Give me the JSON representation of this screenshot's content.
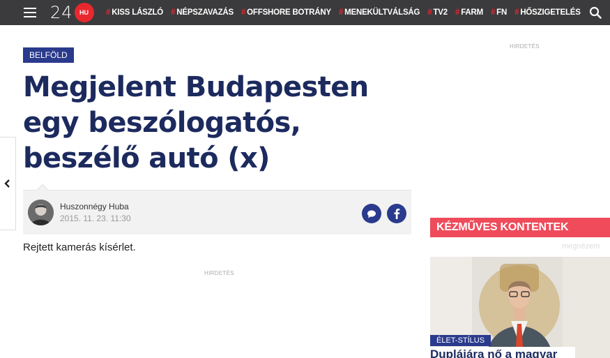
{
  "header": {
    "logo_number": "24",
    "logo_badge": "HU",
    "nav": [
      {
        "label": "KISS LÁSZLÓ"
      },
      {
        "label": "NÉPSZAVAZÁS"
      },
      {
        "label": "OFFSHORE BOTRÁNY"
      },
      {
        "label": "MENEKÜLTVÁLSÁG"
      },
      {
        "label": "TV2"
      },
      {
        "label": "FARM"
      },
      {
        "label": "FN"
      },
      {
        "label": "HŐSZIGETELÉS"
      }
    ],
    "hash_symbol": "#"
  },
  "article": {
    "category": "BELFÖLD",
    "title": "Megjelent Budapesten egy beszólogatós, beszélő autó (x)",
    "author": "Huszonnégy Huba",
    "date": "2015. 11. 23. 11:30",
    "lead": "Rejtett kamerás kísérlet."
  },
  "ads": {
    "label": "HIRDETÉS"
  },
  "sidebar": {
    "promo_header": "KÉZMŰVES KONTENTEK",
    "promo_sub": "megnézem",
    "promo_tag": "ÉLET-STÍLUS",
    "promo_title": "Duplájára nő a magyar"
  },
  "colors": {
    "topbar": "#3b3b3d",
    "accent_red": "#e8282e",
    "brand_blue": "#2a3a8c",
    "title_blue": "#1c2a5e",
    "promo_red": "#ef4b5b"
  }
}
